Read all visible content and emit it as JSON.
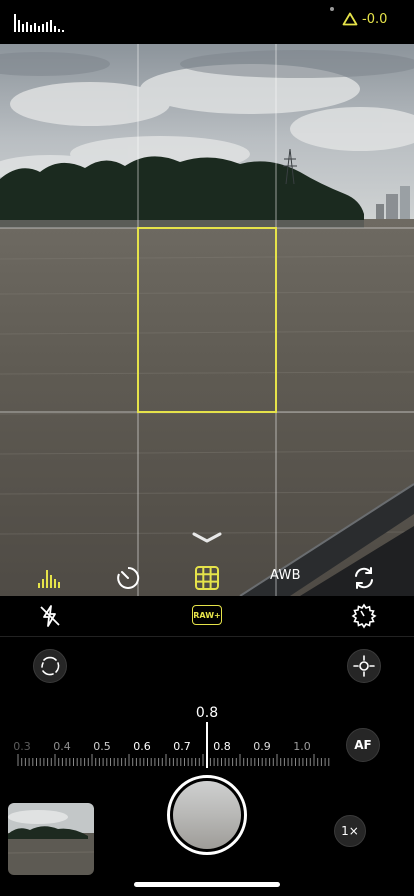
{
  "top_bar": {
    "histogram_icon": "histogram-icon",
    "exposure_icon": "triangle-exposure-icon",
    "exposure_value": "-0.0",
    "accent_color": "#e6e34a"
  },
  "viewfinder": {
    "grid": true,
    "focus_box": true,
    "chevron_icon": "chevron-down-icon"
  },
  "camera_toolbar": {
    "histogram_toggle_icon": "histogram-toggle-icon",
    "timer_icon": "timer-icon",
    "grid_icon": "grid-icon",
    "awb_label": "AWB",
    "flip_camera_icon": "flip-camera-icon"
  },
  "format_row": {
    "flash_icon": "flash-off-icon",
    "format_label": "RAW+",
    "settings_icon": "settings-icon"
  },
  "controls": {
    "left_dial_icon": "lens-dial-icon",
    "right_focus_icon": "focus-crosshair-icon",
    "focus_value": "0.8",
    "scale_labels": [
      "0.3",
      "0.4",
      "0.5",
      "0.6",
      "0.7",
      "0.8",
      "0.9",
      "1.0"
    ],
    "af_label": "AF",
    "zoom_label": "1×"
  },
  "bottom": {
    "thumbnail_label": "last-photo-thumbnail",
    "shutter_label": "shutter-button"
  }
}
